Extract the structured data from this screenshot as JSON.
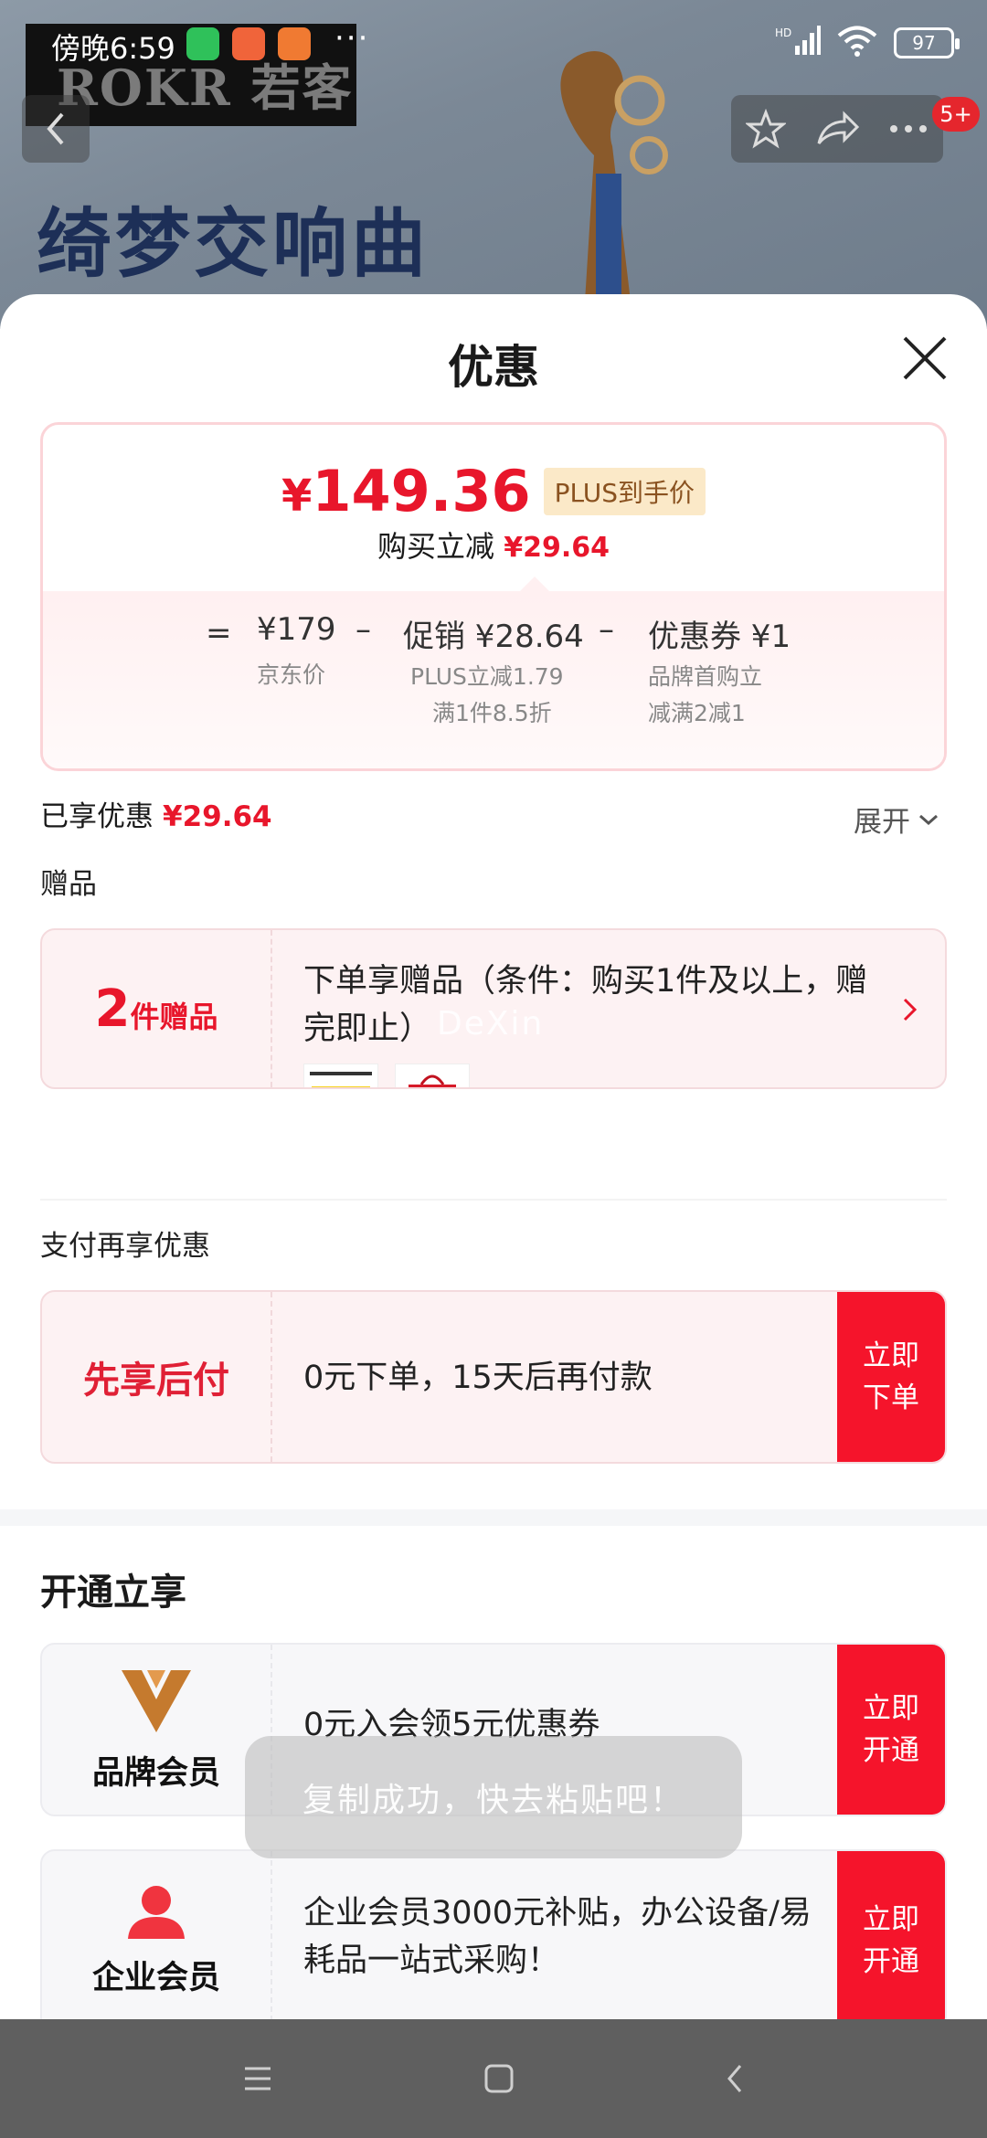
{
  "status_bar": {
    "time": "傍晚6:59",
    "more": "···",
    "network": "HD",
    "battery": "97"
  },
  "background": {
    "brand": "ROKR 若客",
    "promo_title": "绮梦交响曲",
    "cart_badge": "5+"
  },
  "sheet": {
    "title": "优惠"
  },
  "price": {
    "final_yen": "¥",
    "final_amount": "149.36",
    "plus_tag": "PLUS到手价",
    "reduce_label": "购买立减",
    "reduce_amount": "¥29.64",
    "equals": "=",
    "jd_price": "¥179",
    "jd_price_label": "京东价",
    "minus1": "–",
    "promo_label": "促销 ¥28.64",
    "promo_detail_1": "PLUS立减1.79",
    "promo_detail_2": "满1件8.5折",
    "minus2": "–",
    "coupon_label": "优惠券 ¥1",
    "coupon_detail_1": "品牌首购立",
    "coupon_detail_2": "减满2减1"
  },
  "enjoyed": {
    "label": "已享优惠",
    "amount": "¥29.64",
    "expand": "展开"
  },
  "gifts": {
    "section_label": "赠品",
    "count": "2",
    "count_suffix": "件赠品",
    "description": "下单享赠品（条件：购买1件及以上，赠完即止）",
    "watermark": "DeXin"
  },
  "payment": {
    "section_label": "支付再享优惠",
    "title": "先享后付",
    "text": "0元下单，15天后再付款",
    "cta": "立即下单"
  },
  "membership": {
    "heading": "开通立享",
    "brand_member": {
      "name": "品牌会员",
      "text": "0元入会领5元优惠券",
      "cta": "立即开通"
    },
    "enterprise_member": {
      "name": "企业会员",
      "text": " 企业会员3000元补贴，办公设备/易耗品一站式采购！",
      "cta": "立即开通"
    }
  },
  "toast": {
    "text": "复制成功，快去粘贴吧！"
  },
  "colors": {
    "accent_red": "#e8162b",
    "cta_red": "#f5142b",
    "plus_gold_bg": "#fbe9c8",
    "card_pink": "#fdf2f3"
  }
}
